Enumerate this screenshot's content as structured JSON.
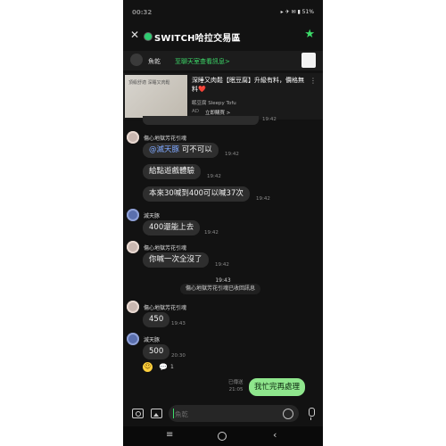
{
  "statusbar": {
    "time": "00:32",
    "icons": "▸ ✈ ✉ ▮ 51%"
  },
  "header": {
    "title": "SWITCH哈拉交易區"
  },
  "notice": {
    "name": "魚乾",
    "text": "至聊天室查看訊息>"
  },
  "ad": {
    "image_text": "頂級舒適 深睡又肉鬆",
    "title": "深睡又肉鬆【眠豆腐】升級有料，價格無料❤️",
    "brand": "眠豆腐 Sleepy Tofu",
    "label": "AD",
    "cta": "立即購買 >"
  },
  "messages": {
    "partial_time": "19:42",
    "s1_name": "傷心地獄芳花引魂",
    "m1_mention": "@滅天豚",
    "m1_text": " 可不可以",
    "m1_time": "19:42",
    "m2_text": "給點遊戲體驗",
    "m2_time": "19:42",
    "m3_text": "本來30喊到400可以喊37次",
    "m3_time": "19:42",
    "s2_name": "滅天豚",
    "m4_text": "400還能上去",
    "m4_time": "19:42",
    "s3_name": "傷心地獄芳花引魂",
    "m5_text": "你喊一次全沒了",
    "m5_time": "19:42",
    "system_time": "19:43",
    "system_text": "傷心地獄芳花引魂已收回訊息",
    "s4_name": "傷心地獄芳花引魂",
    "m6_text": "450",
    "m6_time": "19:43",
    "s5_name": "滅天豚",
    "m7_text": "500",
    "m7_time": "20:30",
    "reaction_count": "1",
    "read_label": "已傳送",
    "read_time": "21:05",
    "my_text": "我忙完再處理"
  },
  "input": {
    "placeholder": "魚乾"
  }
}
